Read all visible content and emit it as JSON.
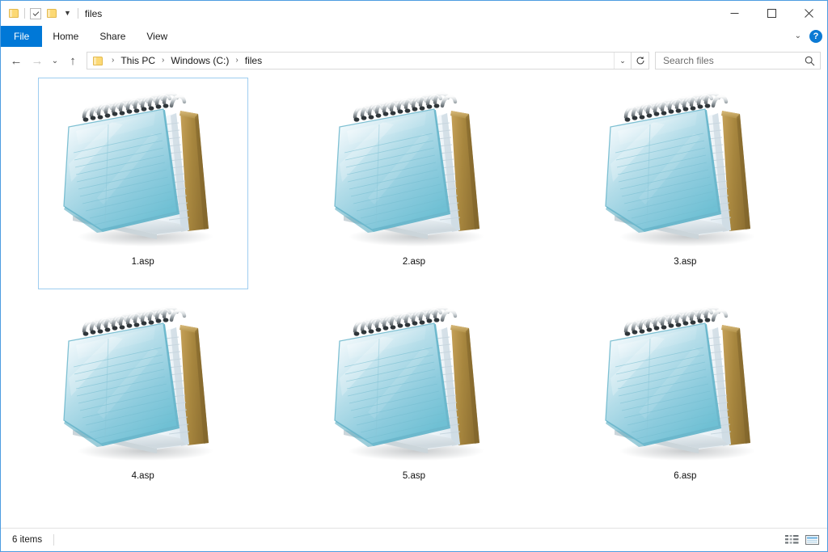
{
  "window": {
    "title": "files",
    "quick_access": {
      "folder_icon": "folder-icon",
      "properties_icon": "properties-checkbox-icon",
      "new_folder_icon": "new-folder-icon",
      "customize_caret": "▼"
    },
    "controls": {
      "minimize": "minimize-icon",
      "maximize": "maximize-icon",
      "close": "close-icon"
    }
  },
  "ribbon": {
    "tabs": [
      {
        "label": "File",
        "active": true
      },
      {
        "label": "Home",
        "active": false
      },
      {
        "label": "Share",
        "active": false
      },
      {
        "label": "View",
        "active": false
      }
    ],
    "expand_caret": "⌄",
    "help_label": "?"
  },
  "navigation": {
    "back": "←",
    "forward": "→",
    "recent": "⌄",
    "up": "↑",
    "breadcrumb": {
      "separator": "›",
      "parts": [
        "This PC",
        "Windows (C:)",
        "files"
      ],
      "dropdown_caret": "⌄"
    },
    "refresh": "refresh-icon"
  },
  "search": {
    "placeholder": "Search files",
    "icon": "search-icon"
  },
  "files": {
    "icon_type": "notepad-file-icon",
    "items": [
      {
        "name": "1.asp",
        "selected": true
      },
      {
        "name": "2.asp",
        "selected": false
      },
      {
        "name": "3.asp",
        "selected": false
      },
      {
        "name": "4.asp",
        "selected": false
      },
      {
        "name": "5.asp",
        "selected": false
      },
      {
        "name": "6.asp",
        "selected": false
      }
    ]
  },
  "status": {
    "item_count": "6 items",
    "view_details_icon": "details-view-icon",
    "view_large_icons_icon": "large-icons-view-icon"
  },
  "colors": {
    "accent": "#0078d7",
    "selection_border": "#9ecdf0",
    "window_border": "#4d9ce0",
    "folder_yellow": "#fcd975",
    "notepad_blue": "#7fc4d6",
    "notepad_cardboard": "#a78441"
  }
}
